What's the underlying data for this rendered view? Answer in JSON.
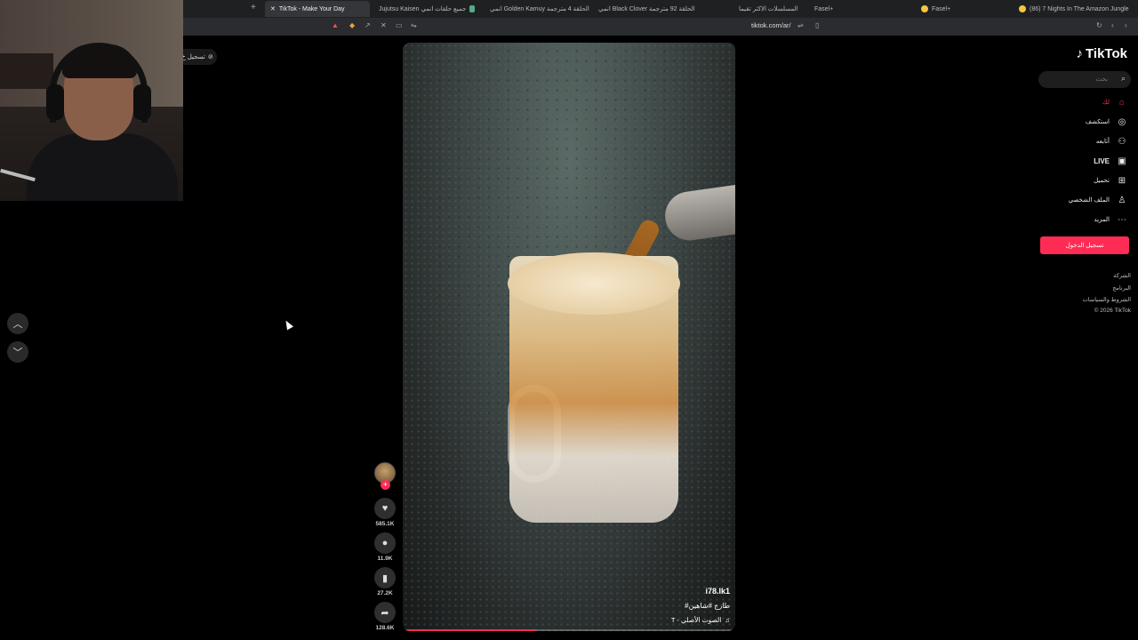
{
  "browser": {
    "tabs": [
      {
        "title": "TikTok - Make Your Day",
        "active": true
      },
      {
        "title": "Jujutsu Kaisen جميع حلقات انمي"
      },
      {
        "title": "انمي Golden Kamuy الحلقة 4 مترجمة"
      },
      {
        "title": "انمي Black Clover الحلقة 92 مترجمة"
      },
      {
        "title": "المسلسلات الاكثر تقيما"
      },
      {
        "title": "Fasel+"
      },
      {
        "title": "Fasel+"
      },
      {
        "title": "(86) 7 Nights In The Amazon Jungle"
      }
    ],
    "url": "tiktok.com/ar/"
  },
  "left": {
    "follow_label": "تسجيل خ"
  },
  "video": {
    "username": "i78.lk1",
    "hashtags": "#طازج #شاهين",
    "music": "T - الصوت الأصلي",
    "progress": 0.4
  },
  "actions": {
    "likes": "585.1K",
    "comments": "11.9K",
    "saves": "27.2K",
    "shares": "128.6K"
  },
  "sidebar": {
    "logo": "TikTok",
    "search_placeholder": "بحث",
    "items": [
      {
        "label": "لك",
        "icon": "home-icon"
      },
      {
        "label": "استكشف",
        "icon": "compass-icon"
      },
      {
        "label": "أتابعه",
        "icon": "following-icon"
      },
      {
        "label": "LIVE",
        "icon": "live-icon"
      },
      {
        "label": "تحميل",
        "icon": "upload-icon"
      },
      {
        "label": "الملف الشخصي",
        "icon": "profile-icon"
      },
      {
        "label": "المزيد",
        "icon": "more-icon"
      }
    ],
    "login_label": "تسجيل الدخول",
    "footer": [
      "الشركة",
      "البرنامج",
      "الشروط والسياسات",
      "© 2026 TikTok"
    ]
  },
  "colors": {
    "accent": "#fe2c55",
    "background": "#000000"
  }
}
